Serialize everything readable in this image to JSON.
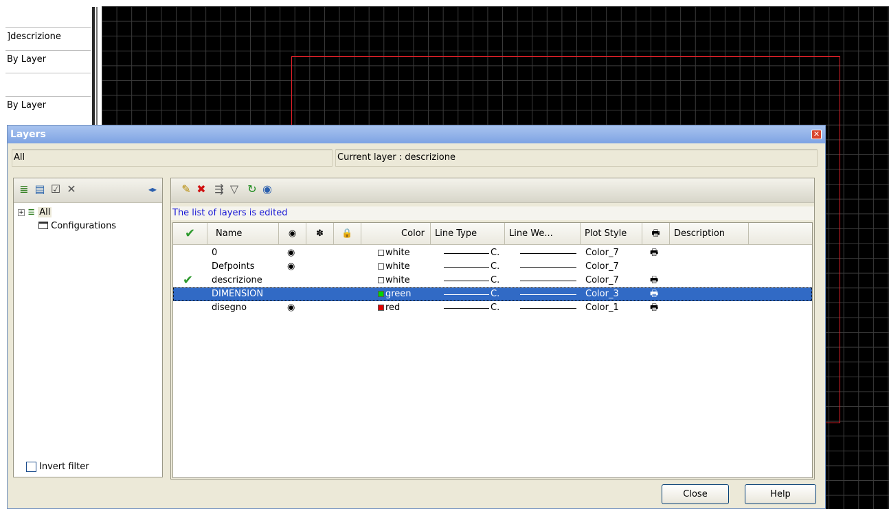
{
  "props_panel": {
    "rows": [
      "]descrizione",
      "By Layer",
      "",
      "By Layer"
    ]
  },
  "dialog": {
    "title": "Layers",
    "filter_field": "All",
    "current_layer": "Current layer : descrizione",
    "status": "The list of layers is edited",
    "tree": [
      {
        "label": "All",
        "icon": "layers-stack-icon"
      },
      {
        "label": "Configurations",
        "icon": "folder-icon"
      }
    ],
    "invert_filter_label": "Invert filter",
    "columns": [
      "Name",
      "Color",
      "Line Type",
      "Line We...",
      "Plot Style",
      "Description"
    ],
    "layers": [
      {
        "name": "0",
        "visible": true,
        "current": false,
        "selected": false,
        "color_name": "white",
        "color_hex": "#ffffff",
        "linetype": "C.",
        "plot_style": "Color_7",
        "plot": true
      },
      {
        "name": "Defpoints",
        "visible": true,
        "current": false,
        "selected": false,
        "color_name": "white",
        "color_hex": "#ffffff",
        "linetype": "C.",
        "plot_style": "Color_7",
        "plot": false
      },
      {
        "name": "descrizione",
        "visible": false,
        "current": true,
        "selected": false,
        "color_name": "white",
        "color_hex": "#ffffff",
        "linetype": "C.",
        "plot_style": "Color_7",
        "plot": true
      },
      {
        "name": "DIMENSION",
        "visible": false,
        "current": false,
        "selected": true,
        "color_name": "green",
        "color_hex": "#00d800",
        "linetype": "C.",
        "plot_style": "Color_3",
        "plot": true
      },
      {
        "name": "disegno",
        "visible": true,
        "current": false,
        "selected": false,
        "color_name": "red",
        "color_hex": "#e00000",
        "linetype": "C.",
        "plot_style": "Color_1",
        "plot": true
      }
    ],
    "buttons": {
      "close": "Close",
      "help": "Help"
    }
  },
  "colors": {
    "titlebar": "#7ea3e3",
    "selection": "#316ac5",
    "status_text": "#1818d6",
    "drawing_rect": "#e8212a"
  }
}
